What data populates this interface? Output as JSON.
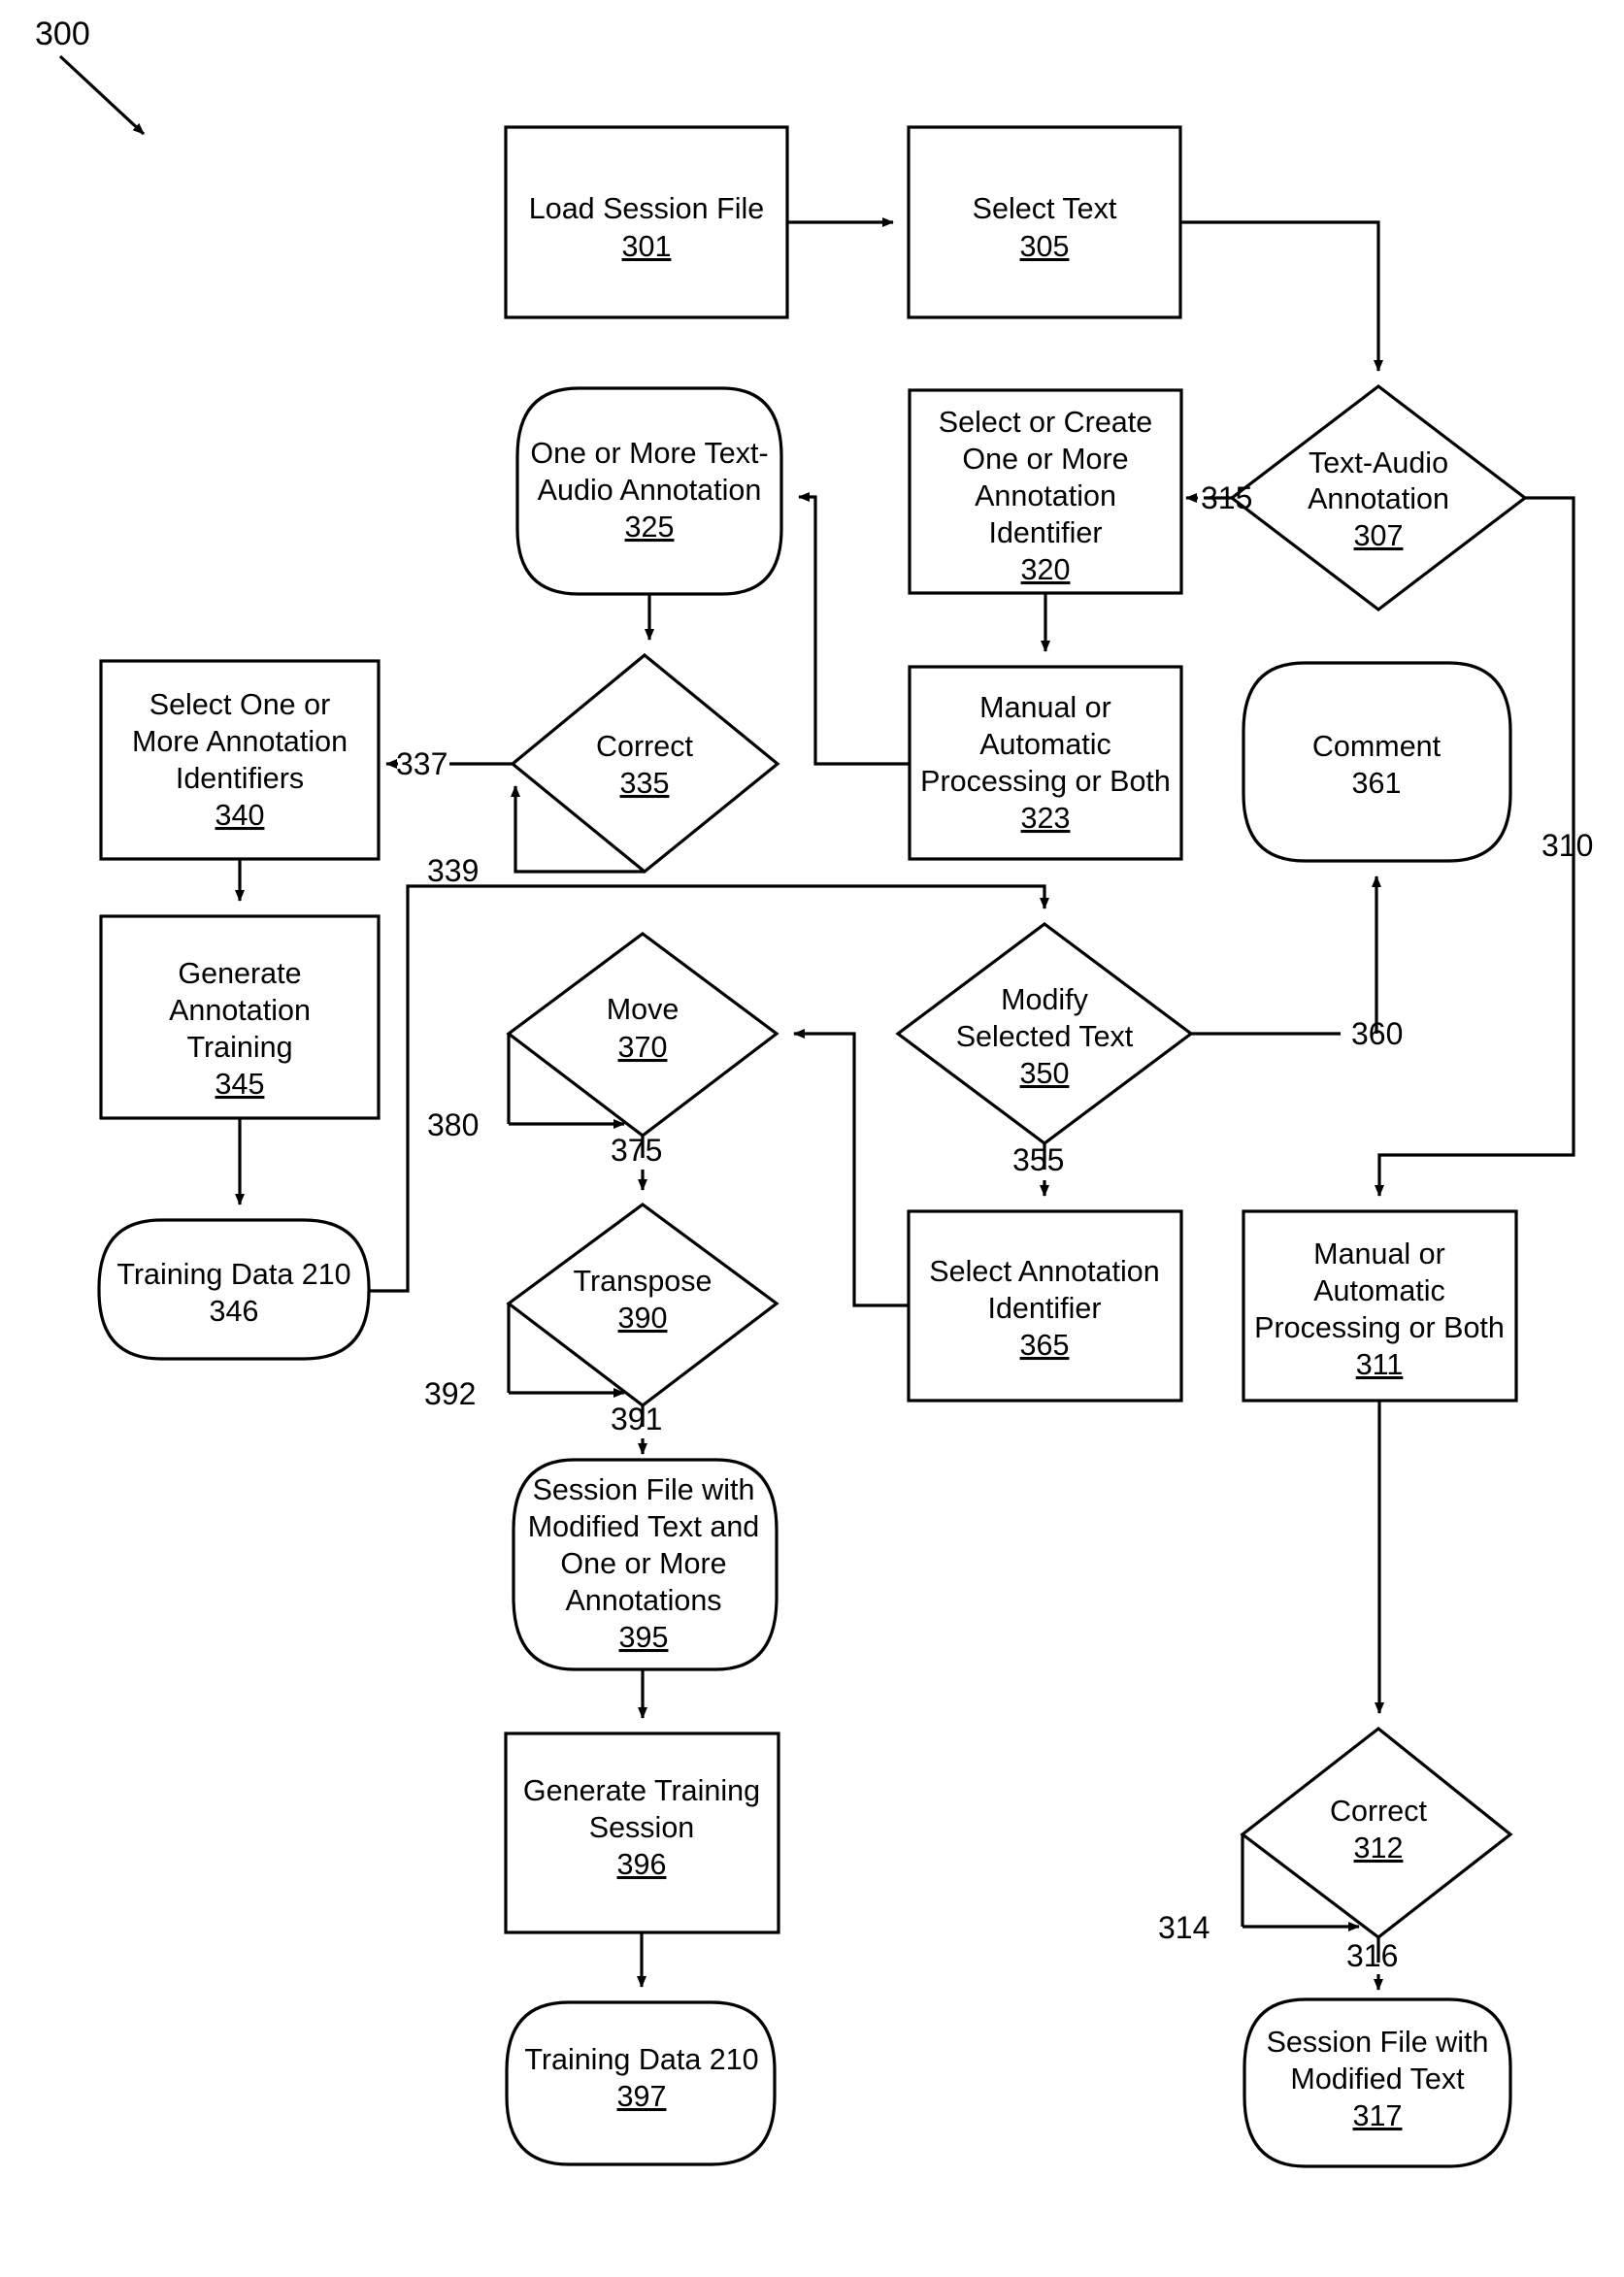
{
  "figure": {
    "number": "300",
    "type": "flowchart"
  },
  "nodes": [
    {
      "id": "301",
      "shape": "rect",
      "label_lines": [
        "Load Session File"
      ],
      "ref": "301",
      "ref_underlined": true
    },
    {
      "id": "305",
      "shape": "rect",
      "label_lines": [
        "Select Text"
      ],
      "ref": "305",
      "ref_underlined": true
    },
    {
      "id": "307",
      "shape": "diamond",
      "label_lines": [
        "Text-Audio",
        "Annotation"
      ],
      "ref": "307",
      "ref_underlined": true
    },
    {
      "id": "320",
      "shape": "rect",
      "label_lines": [
        "Select or Create",
        "One or More",
        "Annotation",
        "Identifier"
      ],
      "ref": "320",
      "ref_underlined": true
    },
    {
      "id": "325",
      "shape": "rounded",
      "label_lines": [
        "One or More Text-",
        "Audio Annotation"
      ],
      "ref": "325",
      "ref_underlined": true
    },
    {
      "id": "323",
      "shape": "rect",
      "label_lines": [
        "Manual or",
        "Automatic",
        "Processing or Both"
      ],
      "ref": "323",
      "ref_underlined": true
    },
    {
      "id": "335",
      "shape": "diamond",
      "label_lines": [
        "Correct"
      ],
      "ref": "335",
      "ref_underlined": true
    },
    {
      "id": "340",
      "shape": "rect",
      "label_lines": [
        "Select One or",
        "More Annotation",
        "Identifiers"
      ],
      "ref": "340",
      "ref_underlined": true
    },
    {
      "id": "345",
      "shape": "rect",
      "label_lines": [
        "Generate",
        "Annotation",
        "Training"
      ],
      "ref": "345",
      "ref_underlined": true
    },
    {
      "id": "346",
      "shape": "rounded",
      "label_lines": [
        "Training Data 210"
      ],
      "ref": "346",
      "ref_underlined": false
    },
    {
      "id": "361",
      "shape": "rounded",
      "label_lines": [
        "Comment"
      ],
      "ref": "361",
      "ref_underlined": false
    },
    {
      "id": "370",
      "shape": "diamond",
      "label_lines": [
        "Move"
      ],
      "ref": "370",
      "ref_underlined": true
    },
    {
      "id": "350",
      "shape": "diamond",
      "label_lines": [
        "Modify",
        "Selected Text"
      ],
      "ref": "350",
      "ref_underlined": true
    },
    {
      "id": "390",
      "shape": "diamond",
      "label_lines": [
        "Transpose"
      ],
      "ref": "390",
      "ref_underlined": true
    },
    {
      "id": "365",
      "shape": "rect",
      "label_lines": [
        "Select Annotation",
        "Identifier"
      ],
      "ref": "365",
      "ref_underlined": true
    },
    {
      "id": "311",
      "shape": "rect",
      "label_lines": [
        "Manual or",
        "Automatic",
        "Processing or Both"
      ],
      "ref": "311",
      "ref_underlined": true
    },
    {
      "id": "395",
      "shape": "rounded",
      "label_lines": [
        "Session File with",
        "Modified Text and",
        "One or More",
        "Annotations"
      ],
      "ref": "395",
      "ref_underlined": true
    },
    {
      "id": "396",
      "shape": "rect",
      "label_lines": [
        "Generate Training",
        "Session"
      ],
      "ref": "396",
      "ref_underlined": true
    },
    {
      "id": "397",
      "shape": "rounded",
      "label_lines": [
        "Training Data 210"
      ],
      "ref": "397",
      "ref_underlined": true
    },
    {
      "id": "312",
      "shape": "diamond",
      "label_lines": [
        "Correct"
      ],
      "ref": "312",
      "ref_underlined": true
    },
    {
      "id": "317",
      "shape": "rounded",
      "label_lines": [
        "Session File with",
        "Modified Text"
      ],
      "ref": "317",
      "ref_underlined": true
    }
  ],
  "edge_labels": [
    {
      "id": "315",
      "text": "315"
    },
    {
      "id": "310",
      "text": "310"
    },
    {
      "id": "337",
      "text": "337"
    },
    {
      "id": "339",
      "text": "339"
    },
    {
      "id": "360",
      "text": "360"
    },
    {
      "id": "355",
      "text": "355"
    },
    {
      "id": "380",
      "text": "380"
    },
    {
      "id": "375",
      "text": "375"
    },
    {
      "id": "392",
      "text": "392"
    },
    {
      "id": "391",
      "text": "391"
    },
    {
      "id": "314",
      "text": "314"
    },
    {
      "id": "316",
      "text": "316"
    }
  ],
  "colors": {
    "stroke": "#000000",
    "background": "#ffffff"
  }
}
